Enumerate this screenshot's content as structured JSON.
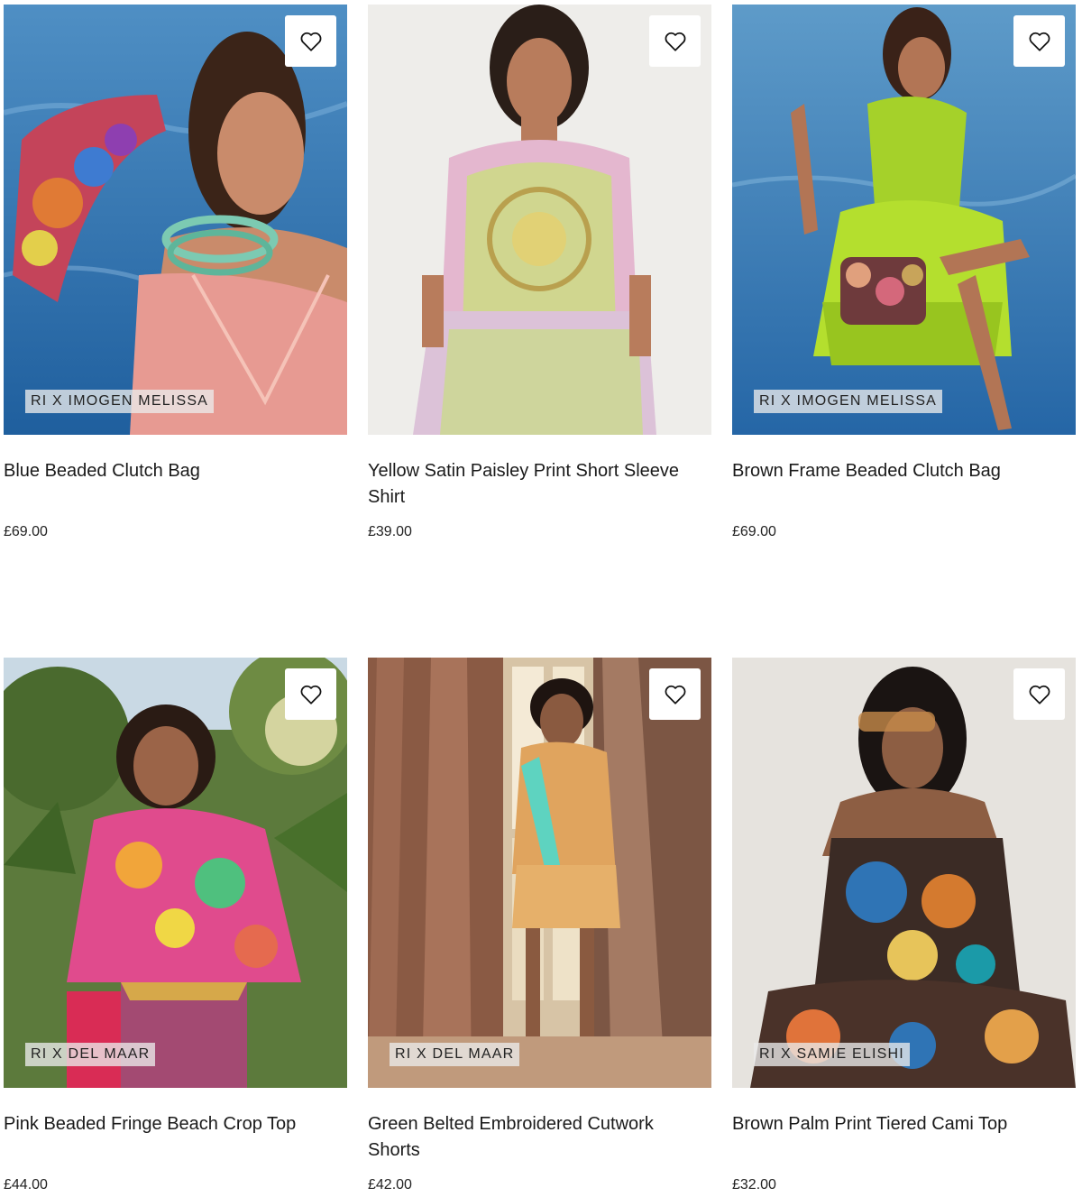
{
  "products": [
    {
      "title": "Blue Beaded Clutch Bag",
      "price": "£69.00",
      "badge": "RI X IMOGEN MELISSA",
      "icon": "heart-icon"
    },
    {
      "title": "Yellow Satin Paisley Print Short Sleeve Shirt",
      "price": "£39.00",
      "badge": "",
      "icon": "heart-icon"
    },
    {
      "title": "Brown Frame Beaded Clutch Bag",
      "price": "£69.00",
      "badge": "RI X IMOGEN MELISSA",
      "icon": "heart-icon"
    },
    {
      "title": "Pink Beaded Fringe Beach Crop Top",
      "price": "£44.00",
      "badge": "RI X DEL MAAR",
      "icon": "heart-icon"
    },
    {
      "title": "Green Belted Embroidered Cutwork Shorts",
      "price": "£42.00",
      "badge": "RI X DEL MAAR",
      "icon": "heart-icon"
    },
    {
      "title": "Brown Palm Print Tiered Cami Top",
      "price": "£32.00",
      "badge": "RI X SAMIE ELISHI",
      "icon": "heart-icon"
    }
  ]
}
